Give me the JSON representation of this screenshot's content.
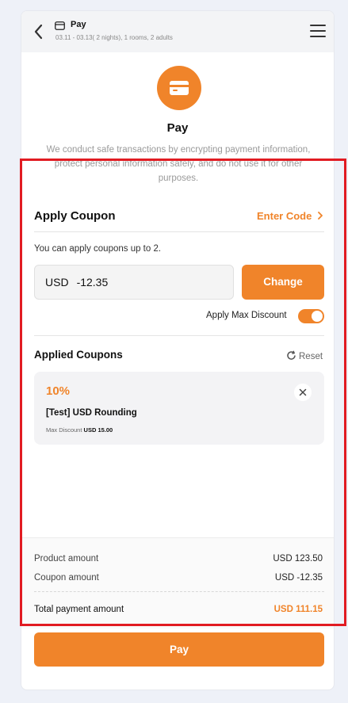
{
  "header": {
    "title": "Pay",
    "subtitle": "03.11 - 03.13( 2 nights), 1 rooms, 2 adults"
  },
  "hero": {
    "title": "Pay",
    "description": "We conduct safe transactions by encrypting payment information, protect personal information safely, and do not use it for other purposes."
  },
  "coupon": {
    "section_title": "Apply Coupon",
    "enter_code_label": "Enter Code",
    "hint": "You can apply coupons up to 2.",
    "amount_currency": "USD",
    "amount_value": "-12.35",
    "change_label": "Change",
    "max_discount_label": "Apply Max Discount",
    "max_discount_on": true
  },
  "applied": {
    "title": "Applied Coupons",
    "reset_label": "Reset",
    "items": [
      {
        "percent": "10%",
        "name": "[Test] USD Rounding",
        "max_label": "Max Discount",
        "max_value": "USD 15.00"
      }
    ]
  },
  "summary": {
    "product_label": "Product amount",
    "product_value": "USD 123.50",
    "coupon_label": "Coupon amount",
    "coupon_value": "USD -12.35",
    "total_label": "Total payment amount",
    "total_value": "USD 111.15"
  },
  "pay_button_label": "Pay",
  "colors": {
    "accent": "#f0842a",
    "highlight_border": "#e11b22"
  }
}
